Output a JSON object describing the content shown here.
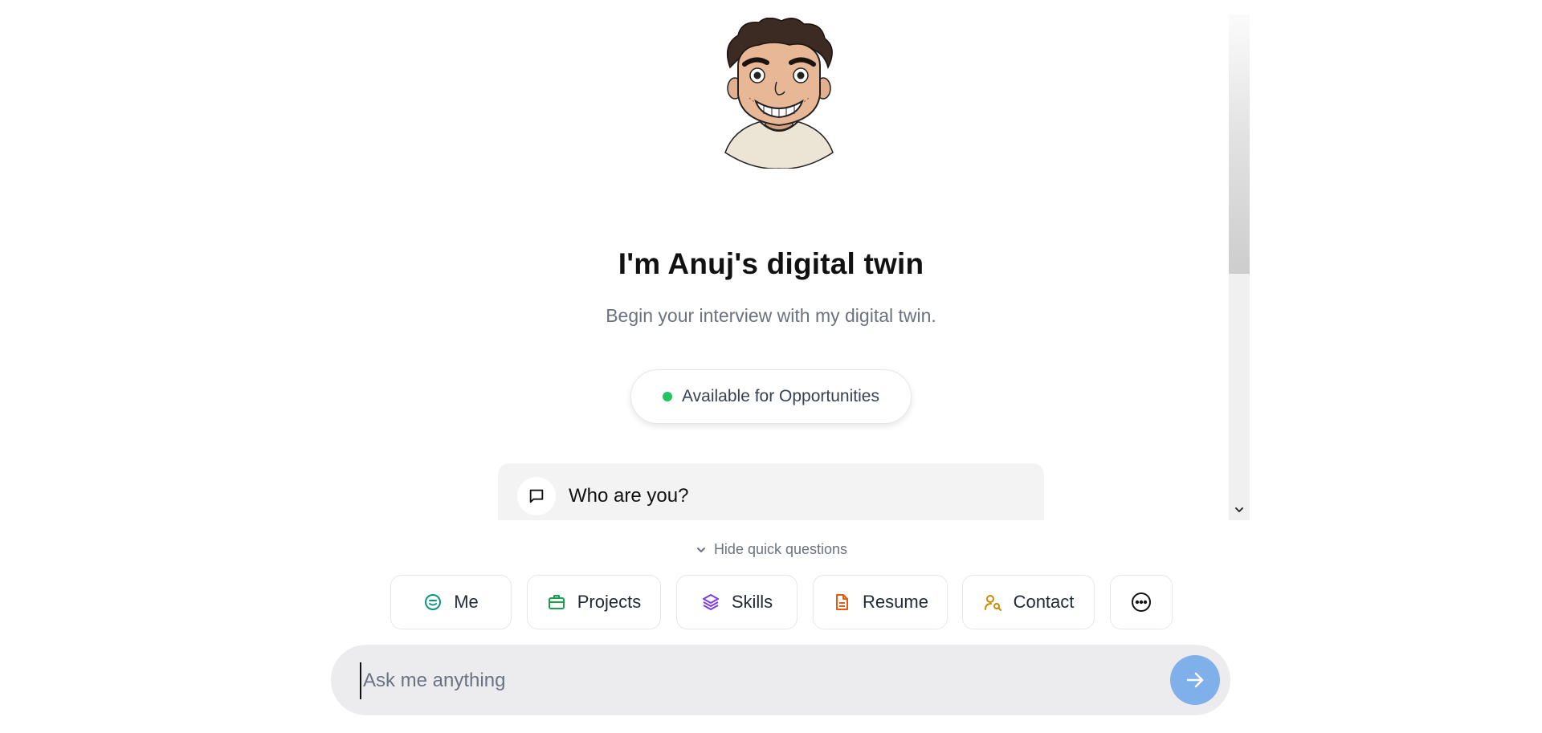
{
  "hero": {
    "title": "I'm Anuj's digital twin",
    "subtitle": "Begin your interview with my digital twin."
  },
  "status": {
    "label": "Available for Opportunities",
    "color": "#22c55e"
  },
  "question_card": {
    "text": "Who are you?",
    "icon": "message-square-icon"
  },
  "quick_questions": {
    "toggle_label": "Hide quick questions",
    "items": [
      {
        "label": "Me",
        "icon": "smile-icon",
        "color": "#0d9488"
      },
      {
        "label": "Projects",
        "icon": "briefcase-icon",
        "color": "#16a34a"
      },
      {
        "label": "Skills",
        "icon": "layers-icon",
        "color": "#7c3aed"
      },
      {
        "label": "Resume",
        "icon": "file-text-icon",
        "color": "#ea580c"
      },
      {
        "label": "Contact",
        "icon": "user-search-icon",
        "color": "#ca8a04"
      },
      {
        "label": "",
        "icon": "more-icon",
        "color": "#111111"
      }
    ]
  },
  "input": {
    "placeholder": "Ask me anything",
    "value": ""
  },
  "send_button": {
    "icon": "arrow-right-icon",
    "color": "#7fb0ea"
  }
}
